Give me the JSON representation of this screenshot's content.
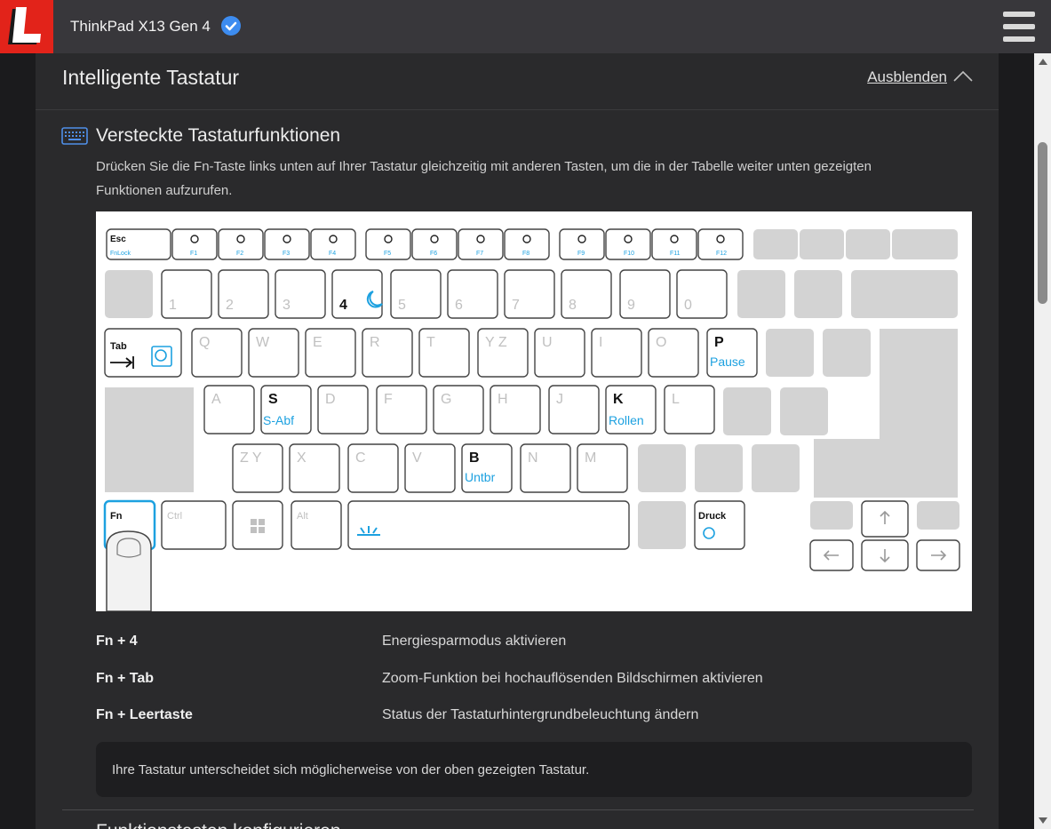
{
  "header": {
    "logo_letter": "L",
    "device_name": "ThinkPad X13 Gen 4",
    "verified_icon": "checkmark-badge-icon",
    "menu_icon": "hamburger-menu-icon"
  },
  "section": {
    "title": "Intelligente Tastatur",
    "collapse_label": "Ausblenden"
  },
  "subsection": {
    "icon": "keyboard-icon",
    "title": "Versteckte Tastaturfunktionen",
    "description": "Drücken Sie die Fn-Taste links unten auf Ihrer Tastatur gleichzeitig mit anderen Tasten, um die in der Tabelle weiter unten gezeigten Funktionen aufzurufen."
  },
  "keyboard": {
    "fn_row": [
      {
        "top": "Esc",
        "sub": "FnLock"
      },
      {
        "icon": "mute-icon",
        "sub": "F1"
      },
      {
        "icon": "volume-down-icon",
        "sub": "F2"
      },
      {
        "icon": "volume-up-icon",
        "sub": "F3"
      },
      {
        "icon": "mic-mute-icon",
        "sub": "F4"
      },
      {
        "icon": "brightness-down-icon",
        "sub": "F5"
      },
      {
        "icon": "brightness-up-icon",
        "sub": "F6"
      },
      {
        "icon": "display-switch-icon",
        "sub": "F7"
      },
      {
        "icon": "airplane-mode-icon",
        "sub": "F8"
      },
      {
        "icon": "notification-icon",
        "sub": "F9"
      },
      {
        "icon": "call-answer-icon",
        "sub": "F10"
      },
      {
        "icon": "call-end-icon",
        "sub": "F11"
      },
      {
        "icon": "star-icon",
        "sub": "F12"
      }
    ],
    "number_row": [
      "1",
      "2",
      "3",
      "4",
      "5",
      "6",
      "7",
      "8",
      "9",
      "0"
    ],
    "qwerty_row": [
      "Q",
      "W",
      "E",
      "R",
      "T",
      "Y Z",
      "U",
      "I",
      "O",
      "P"
    ],
    "asdf_row": [
      "A",
      "S",
      "D",
      "F",
      "G",
      "H",
      "J",
      "K",
      "L"
    ],
    "zxcv_row": [
      "Z Y",
      "X",
      "C",
      "V",
      "B",
      "N",
      "M"
    ],
    "tab_label": "Tab",
    "fn_label": "Fn",
    "ctrl_label": "Ctrl",
    "alt_label": "Alt",
    "druck_label": "Druck",
    "pause_label": "Pause",
    "sabf_label": "S-Abf",
    "rollen_label": "Rollen",
    "untbr_label": "Untbr",
    "accent_color": "#1da1e0"
  },
  "shortcuts": [
    {
      "keys": "Fn + 4",
      "action": "Energiesparmodus aktivieren"
    },
    {
      "keys": "Fn + Tab",
      "action": "Zoom-Funktion bei hochauflösenden Bildschirmen aktivieren"
    },
    {
      "keys": "Fn + Leertaste",
      "action": "Status der Tastaturhintergrundbeleuchtung ändern"
    }
  ],
  "note": "Ihre Tastatur unterscheidet sich möglicherweise von der oben gezeigten Tastatur.",
  "next_section_title": "Funktionstasten konfigurieren"
}
